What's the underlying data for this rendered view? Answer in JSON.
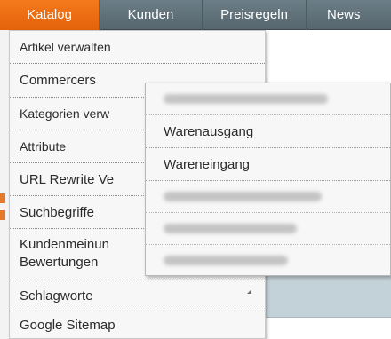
{
  "topnav": {
    "tabs": [
      {
        "label": "Katalog",
        "active": true
      },
      {
        "label": "Kunden"
      },
      {
        "label": "Preisregeln"
      },
      {
        "label": "News"
      }
    ]
  },
  "catalog_menu": {
    "items": [
      {
        "label": "Artikel verwalten"
      },
      {
        "label": "Commercers"
      },
      {
        "label": "Kategorien verw"
      },
      {
        "label": "Attribute"
      },
      {
        "label": "URL Rewrite Ve"
      },
      {
        "label": "Suchbegriffe"
      },
      {
        "label": "Kundenmeinun",
        "label2": "Bewertungen"
      },
      {
        "label": "Schlagworte"
      },
      {
        "label": "Google Sitemap"
      }
    ]
  },
  "commercers_submenu": {
    "items": [
      {
        "label": "Warenausgang"
      },
      {
        "label": "Wareneingang"
      }
    ]
  },
  "colors": {
    "active_tab": "#e86a10",
    "nav_bar": "#5f6f77",
    "menu_bg": "#f7f7f7"
  }
}
